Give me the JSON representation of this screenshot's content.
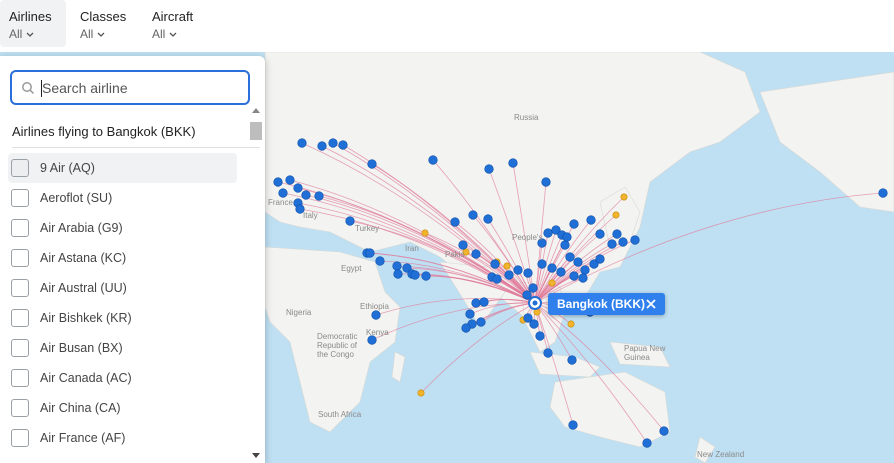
{
  "filters": [
    {
      "label": "Airlines",
      "value": "All"
    },
    {
      "label": "Classes",
      "value": "All"
    },
    {
      "label": "Aircraft",
      "value": "All"
    }
  ],
  "search": {
    "placeholder": "Search airline",
    "value": ""
  },
  "list_title": "Airlines flying to Bangkok (BKK)",
  "airlines": [
    "9 Air (AQ)",
    "Aeroflot (SU)",
    "Air Arabia (G9)",
    "Air Astana (KC)",
    "Air Austral (UU)",
    "Air Bishkek (KR)",
    "Air Busan (BX)",
    "Air Canada (AC)",
    "Air China (CA)",
    "Air France (AF)"
  ],
  "tooltip": {
    "label": "Bangkok (BKK)",
    "close_icon": "close-icon"
  },
  "map_labels": {
    "russia": "Russia",
    "france": "France",
    "italy": "Italy",
    "turkey": "Turkey",
    "iran": "Iran",
    "pakistan": "Pakis",
    "egypt": "Egypt",
    "ethiopia": "Ethiopia",
    "nigeria": "Nigeria",
    "kenya": "Kenya",
    "drc": "Democratic Republic of the Congo",
    "south_africa": "South Africa",
    "peoples": "People's",
    "papua": "Papua New Guinea",
    "new_zealand": "New Zealand"
  },
  "colors": {
    "accent": "#2f80ed",
    "route": "#e07a9a",
    "airport_primary": "#1f6fd6",
    "airport_secondary": "#f2b42a",
    "water": "#bfe0f3",
    "land": "#f3f3f1"
  }
}
